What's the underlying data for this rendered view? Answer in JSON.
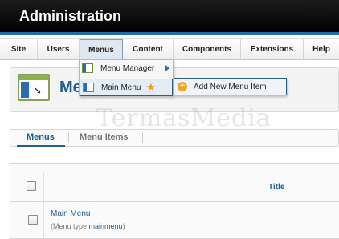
{
  "header": {
    "title": "Administration"
  },
  "menubar": {
    "items": [
      {
        "label": "Site"
      },
      {
        "label": "Users"
      },
      {
        "label": "Menus"
      },
      {
        "label": "Content"
      },
      {
        "label": "Components"
      },
      {
        "label": "Extensions"
      },
      {
        "label": "Help"
      }
    ],
    "active": "Menus"
  },
  "dropdown": {
    "items": [
      {
        "label": "Menu Manager",
        "icon": "menu-manager-icon",
        "has_submenu": true
      },
      {
        "label": "Main Menu",
        "icon": "menu-icon",
        "badge_icon": "star-icon",
        "highlighted": true
      }
    ]
  },
  "submenu": {
    "items": [
      {
        "label": "Add New Menu Item",
        "icon": "add-icon"
      }
    ]
  },
  "page": {
    "title": "Me",
    "icon": "menus-icon"
  },
  "watermark": "TermasMedia",
  "tabs": [
    {
      "label": "Menus",
      "active": true
    },
    {
      "label": "Menu Items",
      "active": false
    }
  ],
  "table": {
    "columns": [
      {
        "label": "Title"
      }
    ],
    "rows": [
      {
        "title": "Main Menu",
        "sub_prefix": "(Menu type ",
        "sub_value": "mainmenu",
        "sub_suffix": ")"
      }
    ]
  },
  "colors": {
    "accent": "#1f5d8c",
    "header_bg": "#111111",
    "header_stripe": "#1f6fa8",
    "star": "#f29a1b"
  }
}
